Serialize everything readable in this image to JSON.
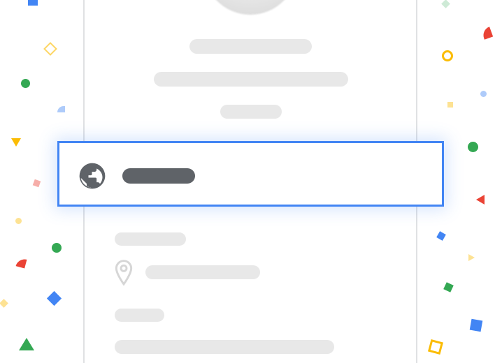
{
  "icons": {
    "globe": "globe-icon",
    "pin": "location-pin-icon"
  },
  "colors": {
    "accent": "#4285f4",
    "placeholder": "#e8e8e8",
    "placeholder_dark": "#5f6368",
    "confetti_blue": "#4285f4",
    "confetti_green": "#34a853",
    "confetti_yellow": "#fbbc04",
    "confetti_red": "#ea4335"
  }
}
